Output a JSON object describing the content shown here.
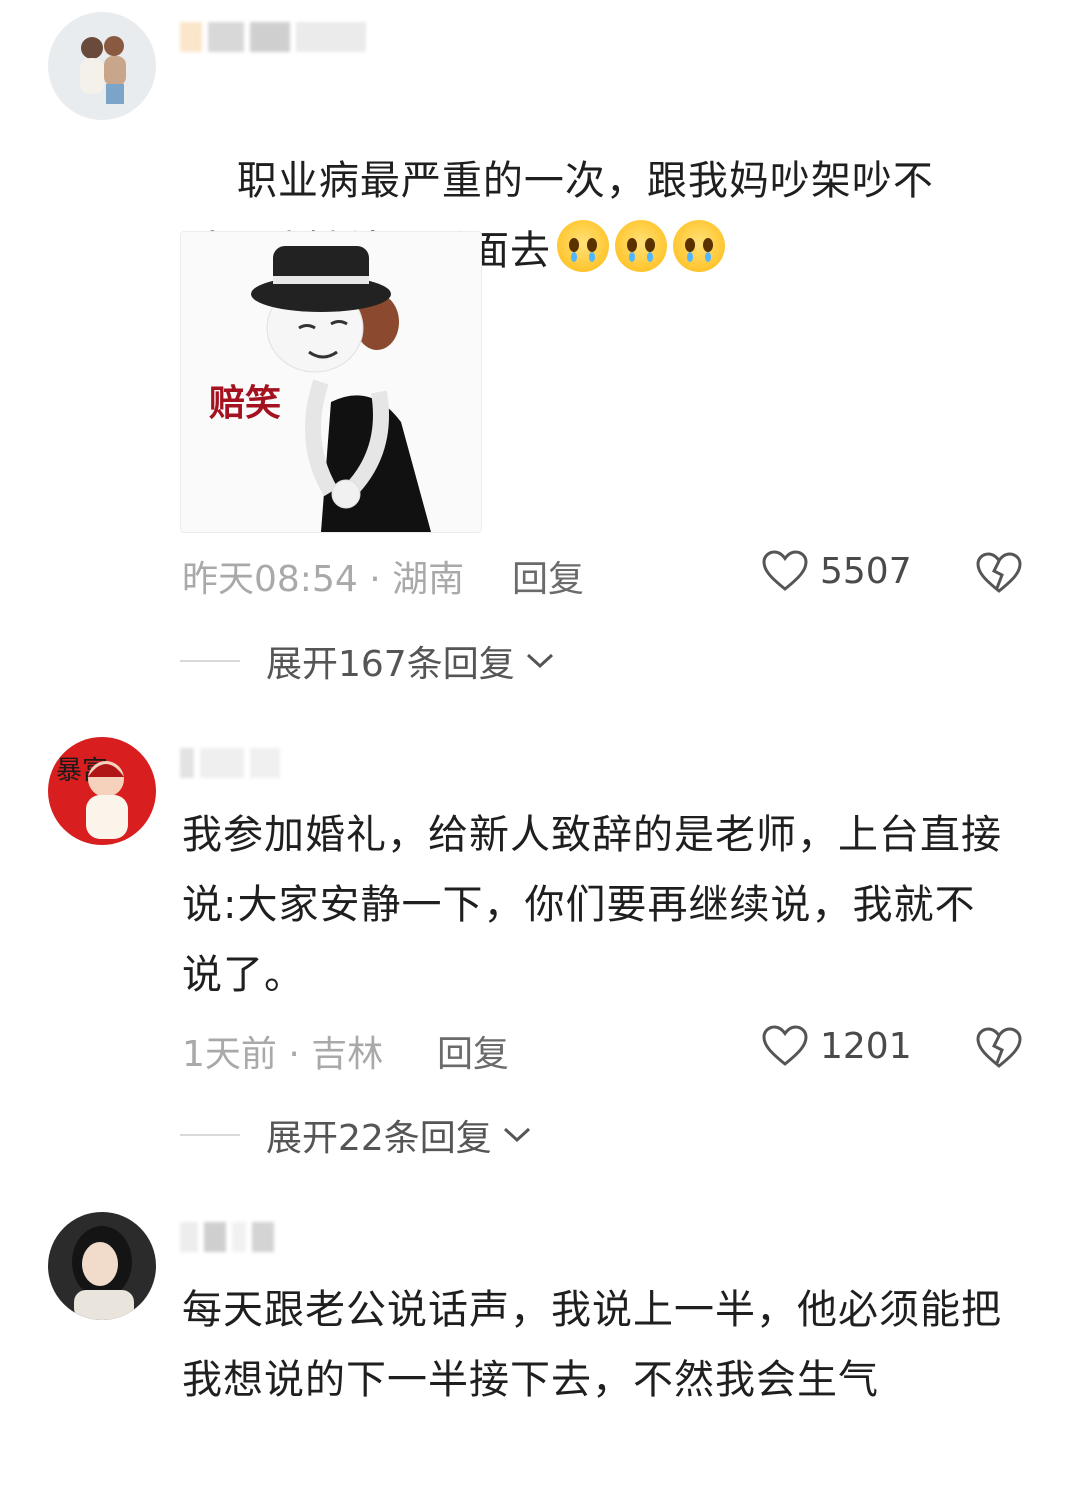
{
  "comments": [
    {
      "text": "职业病最严重的一次，跟我妈吵架吵不过，让她站到后面去",
      "emojis": [
        "crying-emoji",
        "crying-emoji",
        "crying-emoji"
      ],
      "sticker_text": "赔笑",
      "time": "昨天08:54 · 湖南",
      "reply_label": "回复",
      "likes": "5507",
      "expand": "展开167条回复"
    },
    {
      "text": "我参加婚礼，给新人致辞的是老师，上台直接说:大家安静一下，你们要再继续说，我就不说了。",
      "time": "1天前 · 吉林",
      "reply_label": "回复",
      "likes": "1201",
      "expand": "展开22条回复"
    },
    {
      "text": "每天跟老公说话声，我说上一半，他必须能把我想说的下一半接下去，不然我会生气"
    }
  ],
  "avatar2_text": "暴富",
  "colors": {
    "accent_red": "#a3121e",
    "meta_gray": "#a9a9a9"
  }
}
